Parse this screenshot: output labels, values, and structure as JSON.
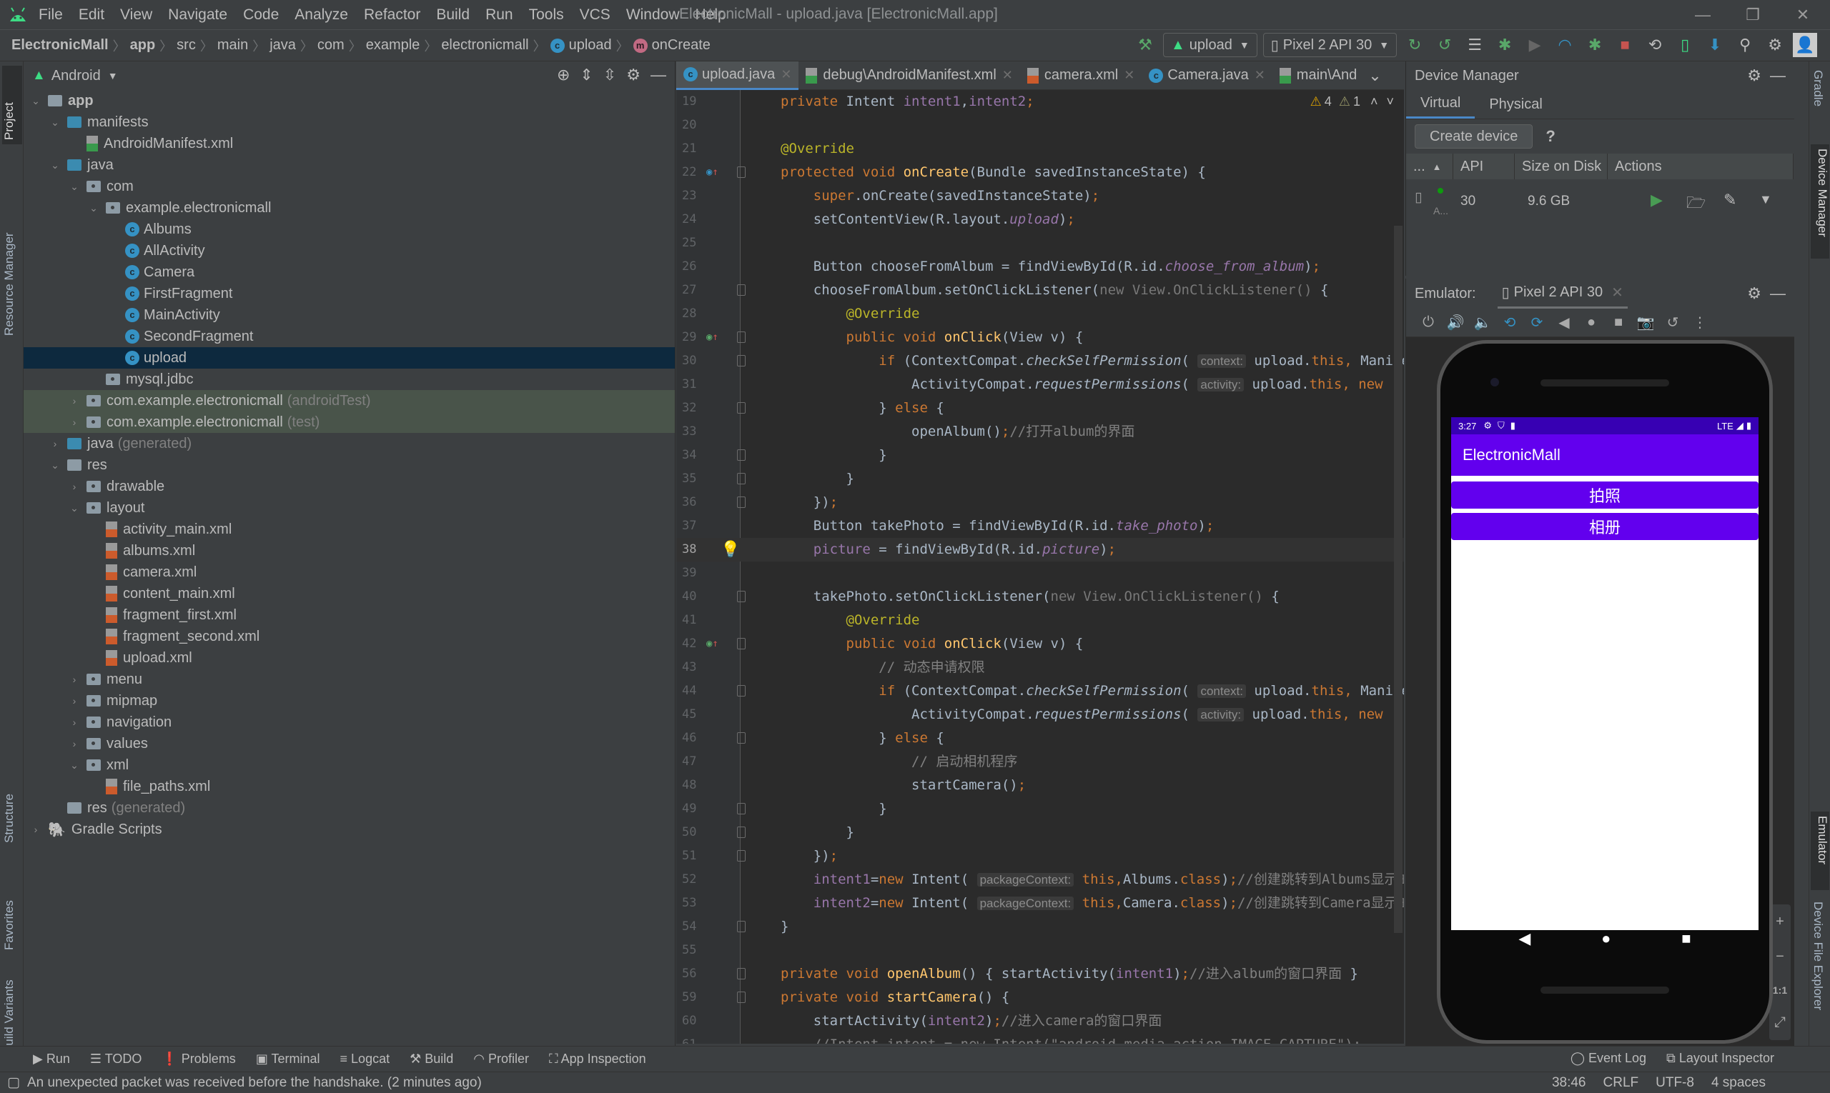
{
  "window": {
    "title": "ElectronicMall - upload.java [ElectronicMall.app]",
    "menu": [
      "File",
      "Edit",
      "View",
      "Navigate",
      "Code",
      "Analyze",
      "Refactor",
      "Build",
      "Run",
      "Tools",
      "VCS",
      "Window",
      "Help"
    ],
    "controls": {
      "minimize": "—",
      "restore": "❐",
      "close": "✕"
    }
  },
  "breadcrumb": [
    "ElectronicMall",
    "app",
    "src",
    "main",
    "java",
    "com",
    "example",
    "electronicmall",
    "upload",
    "onCreate"
  ],
  "toolbar": {
    "run_config": "upload",
    "device": "Pixel 2 API 30"
  },
  "left_stripe": [
    "Project",
    "Resource Manager",
    "Structure",
    "Favorites",
    "Build Variants"
  ],
  "project": {
    "view": "Android",
    "tree": [
      {
        "label": "app",
        "depth": 0,
        "arrow": "v",
        "icon": "module"
      },
      {
        "label": "manifests",
        "depth": 1,
        "arrow": "v",
        "icon": "folder-blue"
      },
      {
        "label": "AndroidManifest.xml",
        "depth": 2,
        "arrow": "",
        "icon": "manifest"
      },
      {
        "label": "java",
        "depth": 1,
        "arrow": "v",
        "icon": "folder-blue"
      },
      {
        "label": "com",
        "depth": 2,
        "arrow": "v",
        "icon": "package"
      },
      {
        "label": "example.electronicmall",
        "depth": 3,
        "arrow": "v",
        "icon": "package"
      },
      {
        "label": "Albums",
        "depth": 4,
        "arrow": "",
        "icon": "class"
      },
      {
        "label": "AllActivity",
        "depth": 4,
        "arrow": "",
        "icon": "class"
      },
      {
        "label": "Camera",
        "depth": 4,
        "arrow": "",
        "icon": "class"
      },
      {
        "label": "FirstFragment",
        "depth": 4,
        "arrow": "",
        "icon": "class"
      },
      {
        "label": "MainActivity",
        "depth": 4,
        "arrow": "",
        "icon": "class"
      },
      {
        "label": "SecondFragment",
        "depth": 4,
        "arrow": "",
        "icon": "class"
      },
      {
        "label": "upload",
        "depth": 4,
        "arrow": "",
        "icon": "class",
        "selected": true
      },
      {
        "label": "mysql.jdbc",
        "depth": 3,
        "arrow": "",
        "icon": "package"
      },
      {
        "label": "com.example.electronicmall",
        "suffix": "(androidTest)",
        "depth": 2,
        "arrow": ">",
        "icon": "package",
        "test": true
      },
      {
        "label": "com.example.electronicmall",
        "suffix": "(test)",
        "depth": 2,
        "arrow": ">",
        "icon": "package",
        "test": true
      },
      {
        "label": "java",
        "suffix": "(generated)",
        "depth": 1,
        "arrow": ">",
        "icon": "folder-blue"
      },
      {
        "label": "res",
        "depth": 1,
        "arrow": "v",
        "icon": "folder"
      },
      {
        "label": "drawable",
        "depth": 2,
        "arrow": ">",
        "icon": "package"
      },
      {
        "label": "layout",
        "depth": 2,
        "arrow": "v",
        "icon": "package"
      },
      {
        "label": "activity_main.xml",
        "depth": 3,
        "arrow": "",
        "icon": "xml"
      },
      {
        "label": "albums.xml",
        "depth": 3,
        "arrow": "",
        "icon": "xml"
      },
      {
        "label": "camera.xml",
        "depth": 3,
        "arrow": "",
        "icon": "xml"
      },
      {
        "label": "content_main.xml",
        "depth": 3,
        "arrow": "",
        "icon": "xml"
      },
      {
        "label": "fragment_first.xml",
        "depth": 3,
        "arrow": "",
        "icon": "xml"
      },
      {
        "label": "fragment_second.xml",
        "depth": 3,
        "arrow": "",
        "icon": "xml"
      },
      {
        "label": "upload.xml",
        "depth": 3,
        "arrow": "",
        "icon": "xml"
      },
      {
        "label": "menu",
        "depth": 2,
        "arrow": ">",
        "icon": "package"
      },
      {
        "label": "mipmap",
        "depth": 2,
        "arrow": ">",
        "icon": "package"
      },
      {
        "label": "navigation",
        "depth": 2,
        "arrow": ">",
        "icon": "package"
      },
      {
        "label": "values",
        "depth": 2,
        "arrow": ">",
        "icon": "package"
      },
      {
        "label": "xml",
        "depth": 2,
        "arrow": "v",
        "icon": "package"
      },
      {
        "label": "file_paths.xml",
        "depth": 3,
        "arrow": "",
        "icon": "xml"
      },
      {
        "label": "res",
        "suffix": "(generated)",
        "depth": 1,
        "arrow": "",
        "icon": "folder"
      },
      {
        "label": "Gradle Scripts",
        "depth": 0,
        "arrow": ">",
        "icon": "gradle"
      }
    ]
  },
  "editor": {
    "tabs": [
      {
        "label": "upload.java",
        "icon": "class",
        "active": true
      },
      {
        "label": "debug\\AndroidManifest.xml",
        "icon": "manifest"
      },
      {
        "label": "camera.xml",
        "icon": "xml"
      },
      {
        "label": "Camera.java",
        "icon": "class"
      },
      {
        "label": "main\\And",
        "icon": "manifest"
      }
    ],
    "inspections": {
      "warnings": "4",
      "weak_warnings": "1"
    },
    "current_line": 38,
    "lines": [
      {
        "n": "19",
        "html": "<span class='kw'>private</span> Intent <span class='fld'>intent1</span>,<span class='fld'>intent2</span><span class='kw'>;</span>"
      },
      {
        "n": "20",
        "html": ""
      },
      {
        "n": "21",
        "html": "<span class='ann'>@Override</span>"
      },
      {
        "n": "22",
        "html": "<span class='kw'>protected void </span><span class='fn'>onCreate</span>(Bundle savedInstanceState) {",
        "mark": "override"
      },
      {
        "n": "23",
        "html": "    <span class='kw'>super</span>.onCreate(savedInstanceState)<span class='kw'>;</span>"
      },
      {
        "n": "24",
        "html": "    setContentView(R.layout.<span class='fld ital'>upload</span>)<span class='kw'>;</span>"
      },
      {
        "n": "25",
        "html": ""
      },
      {
        "n": "26",
        "html": "    Button chooseFromAlbum = findViewById(R.id.<span class='fld ital'>choose_from_album</span>)<span class='kw'>;</span>"
      },
      {
        "n": "27",
        "html": "    chooseFromAlbum.setOnClickListener(<span class='gr'>new View.OnClickListener()</span> {"
      },
      {
        "n": "28",
        "html": "        <span class='ann'>@Override</span>"
      },
      {
        "n": "29",
        "html": "        <span class='kw'>public void </span><span class='fn'>onClick</span>(View v) {",
        "mark": "implement"
      },
      {
        "n": "30",
        "html": "            <span class='kw'>if </span>(ContextCompat.<span class='ital'>checkSelfPermission</span>( <span class='hint'>context:</span> upload.<span class='kw'>this, </span>Manifest"
      },
      {
        "n": "31",
        "html": "                ActivityCompat.<span class='ital'>requestPermissions</span>( <span class='hint'>activity:</span> upload.<span class='kw'>this, new</span>"
      },
      {
        "n": "32",
        "html": "            } <span class='kw'>else </span>{"
      },
      {
        "n": "33",
        "html": "                openAlbum()<span class='kw'>;</span><span class='cm'>//打开album的界面</span>"
      },
      {
        "n": "34",
        "html": "            }"
      },
      {
        "n": "35",
        "html": "        }"
      },
      {
        "n": "36",
        "html": "    })<span class='kw'>;</span>"
      },
      {
        "n": "37",
        "html": "    Button takePhoto = findViewById(R.id.<span class='fld ital'>take_photo</span>)<span class='kw'>;</span>"
      },
      {
        "n": "38",
        "html": "    <span class='fld'>picture</span> = findViewById(R.id.<span class='fld ital'>picture</span>)<span class='kw'>;</span>",
        "mark": "bulb"
      },
      {
        "n": "39",
        "html": ""
      },
      {
        "n": "40",
        "html": "    takePhoto.setOnClickListener(<span class='gr'>new View.OnClickListener()</span> {"
      },
      {
        "n": "41",
        "html": "        <span class='ann'>@Override</span>"
      },
      {
        "n": "42",
        "html": "        <span class='kw'>public void </span><span class='fn'>onClick</span>(View v) {",
        "mark": "implement"
      },
      {
        "n": "43",
        "html": "            <span class='cm'>// 动态申请权限</span>"
      },
      {
        "n": "44",
        "html": "            <span class='kw'>if </span>(ContextCompat.<span class='ital'>checkSelfPermission</span>( <span class='hint'>context:</span> upload.<span class='kw'>this, </span>Manifest"
      },
      {
        "n": "45",
        "html": "                ActivityCompat.<span class='ital'>requestPermissions</span>( <span class='hint'>activity:</span> upload.<span class='kw'>this, new</span>"
      },
      {
        "n": "46",
        "html": "            } <span class='kw'>else </span>{"
      },
      {
        "n": "47",
        "html": "                <span class='cm'>// 启动相机程序</span>"
      },
      {
        "n": "48",
        "html": "                startCamera()<span class='kw'>;</span>"
      },
      {
        "n": "49",
        "html": "            }"
      },
      {
        "n": "50",
        "html": "        }"
      },
      {
        "n": "51",
        "html": "    })<span class='kw'>;</span>"
      },
      {
        "n": "52",
        "html": "    <span class='fld'>intent1</span>=<span class='kw'>new </span>Intent( <span class='hint'>packageContext:</span> <span class='kw'>this,</span>Albums.<span class='kw'>class</span>)<span class='kw'>;</span><span class='cm'>//创建跳转到Albums显示的窗口的Intent</span>"
      },
      {
        "n": "53",
        "html": "    <span class='fld'>intent2</span>=<span class='kw'>new </span>Intent( <span class='hint'>packageContext:</span> <span class='kw'>this,</span>Camera.<span class='kw'>class</span>)<span class='kw'>;</span><span class='cm'>//创建跳转到Camera显示的窗口的Intent</span>"
      },
      {
        "n": "54",
        "html": "}"
      },
      {
        "n": "55",
        "html": ""
      },
      {
        "n": "56",
        "html": "<span class='kw'>private void </span><span class='fn'>openAlbum</span>() { startActivity(<span class='fld'>intent1</span>)<span class='kw'>;</span><span class='cm'>//进入album的窗口界面</span> }"
      },
      {
        "n": "59",
        "html": "<span class='kw'>private void </span><span class='fn'>startCamera</span>() {"
      },
      {
        "n": "60",
        "html": "    startActivity(<span class='fld'>intent2</span>)<span class='kw'>;</span><span class='cm'>//进入camera的窗口界面</span>"
      },
      {
        "n": "61",
        "html": "    <span class='cm'>//Intent intent = new Intent(\"android.media.action.IMAGE_CAPTURE\");</span>"
      }
    ]
  },
  "device_manager": {
    "title": "Device Manager",
    "tabs": [
      "Virtual",
      "Physical"
    ],
    "create_button": "Create device",
    "help": "?",
    "columns": [
      "...",
      "API",
      "Size on Disk",
      "Actions"
    ],
    "rows": [
      {
        "name": "A...",
        "api": "30",
        "size": "9.6 GB",
        "online": true
      }
    ]
  },
  "emulator": {
    "label": "Emulator:",
    "tab": "Pixel 2 API 30",
    "zoom_controls": [
      "+",
      "−",
      "1:1",
      "⤢"
    ],
    "phone": {
      "time": "3:27",
      "network": "LTE",
      "app_title": "ElectronicMall",
      "buttons": [
        "拍照",
        "相册"
      ]
    }
  },
  "right_stripe": [
    "Gradle",
    "Device Manager",
    "Emulator",
    "Device File Explorer"
  ],
  "bottom_tools": [
    "Run",
    "TODO",
    "Problems",
    "Terminal",
    "Logcat",
    "Build",
    "Profiler",
    "App Inspection"
  ],
  "bottom_tools_right": [
    "Event Log",
    "Layout Inspector"
  ],
  "status": {
    "message": "An unexpected packet was received before the handshake. (2 minutes ago)",
    "position": "38:46",
    "line_sep": "CRLF",
    "encoding": "UTF-8",
    "indent": "4 spaces"
  },
  "colors": {
    "accent": "#4a88c7",
    "app_primary": "#6200ee",
    "app_status": "#3700b3"
  }
}
